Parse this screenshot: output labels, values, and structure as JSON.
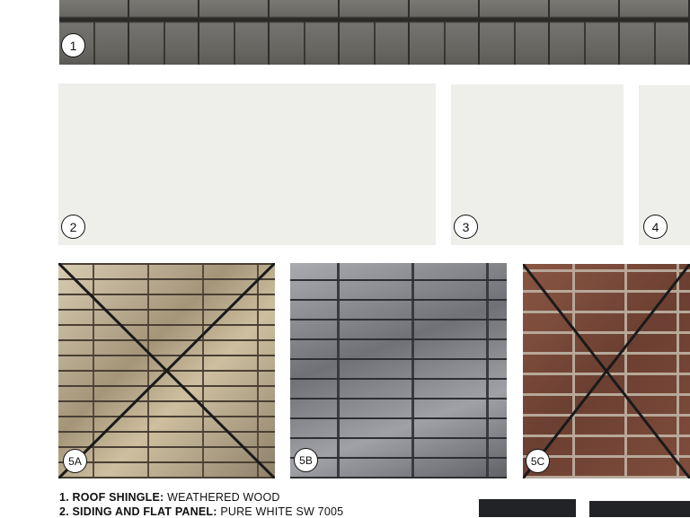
{
  "badges": {
    "b1": "1",
    "b2": "2",
    "b3": "3",
    "b4": "4",
    "b5a": "5A",
    "b5b": "5B",
    "b5c": "5C"
  },
  "legend": [
    {
      "num": "1.",
      "label": "ROOF SHINGLE:",
      "value": "WEATHERED WOOD"
    },
    {
      "num": "2.",
      "label": "SIDING AND FLAT PANEL:",
      "value": "PURE WHITE SW 7005"
    }
  ],
  "colors": {
    "swatch": "#eeeeea",
    "cross": "#1a1a1a",
    "dark_swatch": "#222326"
  },
  "crossed_out": [
    "5A",
    "5C"
  ]
}
